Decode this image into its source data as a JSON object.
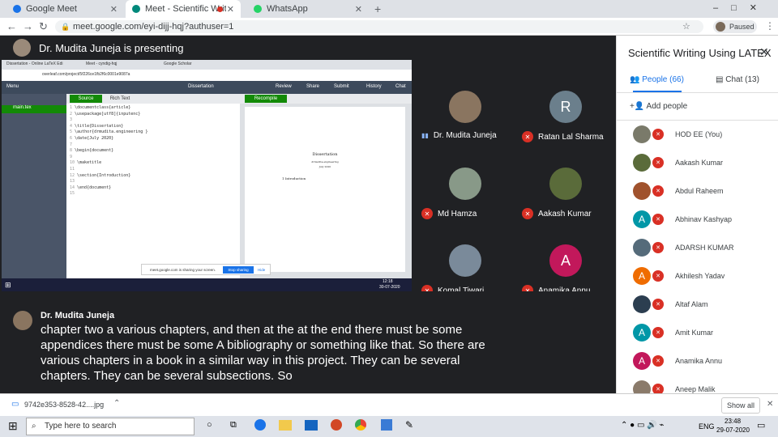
{
  "tabs": [
    {
      "label": "Google Meet",
      "color": "#1a73e8"
    },
    {
      "label": "Meet - Scientific Writing Usi",
      "color": "#00897b"
    },
    {
      "label": "WhatsApp",
      "color": "#25d366"
    }
  ],
  "address": {
    "url": "meet.google.com/eyi-dijj-hqj?authuser=1",
    "profile": "Paused"
  },
  "presenter": {
    "banner": "Dr. Mudita Juneja is presenting"
  },
  "share": {
    "browser_tabs": [
      "Dissertation - Online LaTeX Edi",
      "Meet - cyndig-hqj",
      "Google Scholar"
    ],
    "url": "overleaf.com/project/5f226ce1fb2f6c0001e9087a",
    "title": "Dissertation",
    "menu": "Menu",
    "toolbar": [
      "Review",
      "Share",
      "Submit",
      "History",
      "Chat"
    ],
    "source_tab": "Source",
    "rich_tab": "Rich Text",
    "recompile": "Recompile",
    "file": "main.tex",
    "code": [
      "\\documentclass{article}",
      "\\usepackage[utf8]{inputenc}",
      "",
      "\\title{Dissertation}",
      "\\author{drmudita.engineering }",
      "\\date{July 2020}",
      "",
      "\\begin{document}",
      "",
      "\\maketitle",
      "",
      "\\section{Introduction}",
      "",
      "\\end{document}",
      ""
    ],
    "pdf": {
      "title": "Dissertation",
      "author": "drmudita.engineering",
      "date": "July 2020",
      "section": "1 Introduction"
    },
    "sharing_msg": "meet.google.com is sharing your screen.",
    "stop": "Stop sharing",
    "hide": "Hide",
    "clock": "12:18",
    "date": "30-07-2020"
  },
  "tiles": [
    {
      "name": "Dr. Mudita Juneja",
      "initial": "",
      "color": "#8a7560",
      "speaking": true
    },
    {
      "name": "Ratan Lal Sharma",
      "initial": "R",
      "color": "#6b7f8c",
      "speaking": false
    },
    {
      "name": "Md Hamza",
      "initial": "",
      "color": "#889988",
      "speaking": false
    },
    {
      "name": "Aakash Kumar",
      "initial": "",
      "color": "#5a6b3a",
      "speaking": false
    },
    {
      "name": "Komal Tiwari",
      "initial": "",
      "color": "#7a8a9a",
      "speaking": false
    },
    {
      "name": "Anamika Annu",
      "initial": "A",
      "color": "#c2185b",
      "speaking": false
    }
  ],
  "caption": {
    "speaker": "Dr. Mudita Juneja",
    "text": "chapter two a various chapters, and then at the at the end there must be some appendices there must be some A bibliography or something like that. So there are various chapters in a book in a similar way in this project. They can be several chapters. They can be several subsections. So"
  },
  "panel": {
    "title": "Scientific Writing Using LATEX",
    "people_tab": "People (66)",
    "chat_tab": "Chat (13)",
    "add": "Add people",
    "people": [
      {
        "name": "HOD EE (You)",
        "initial": "",
        "color": "#7a7a6a"
      },
      {
        "name": "Aakash Kumar",
        "initial": "",
        "color": "#5a6b3a"
      },
      {
        "name": "Abdul Raheem",
        "initial": "",
        "color": "#a0522d"
      },
      {
        "name": "Abhinav Kashyap",
        "initial": "A",
        "color": "#0097a7"
      },
      {
        "name": "ADARSH KUMAR",
        "initial": "",
        "color": "#556b7a"
      },
      {
        "name": "Akhilesh Yadav",
        "initial": "A",
        "color": "#ef6c00"
      },
      {
        "name": "Altaf Alam",
        "initial": "",
        "color": "#2c3e50"
      },
      {
        "name": "Amit Kumar",
        "initial": "A",
        "color": "#0097a7"
      },
      {
        "name": "Anamika Annu",
        "initial": "A",
        "color": "#c2185b"
      },
      {
        "name": "Aneep Malik",
        "initial": "",
        "color": "#8a7a6a"
      }
    ]
  },
  "download": {
    "file": "9742e353-8528-42....jpg",
    "show_all": "Show all"
  },
  "taskbar": {
    "search": "Type here to search",
    "lang": "ENG",
    "time": "23:48",
    "date": "29-07-2020"
  }
}
